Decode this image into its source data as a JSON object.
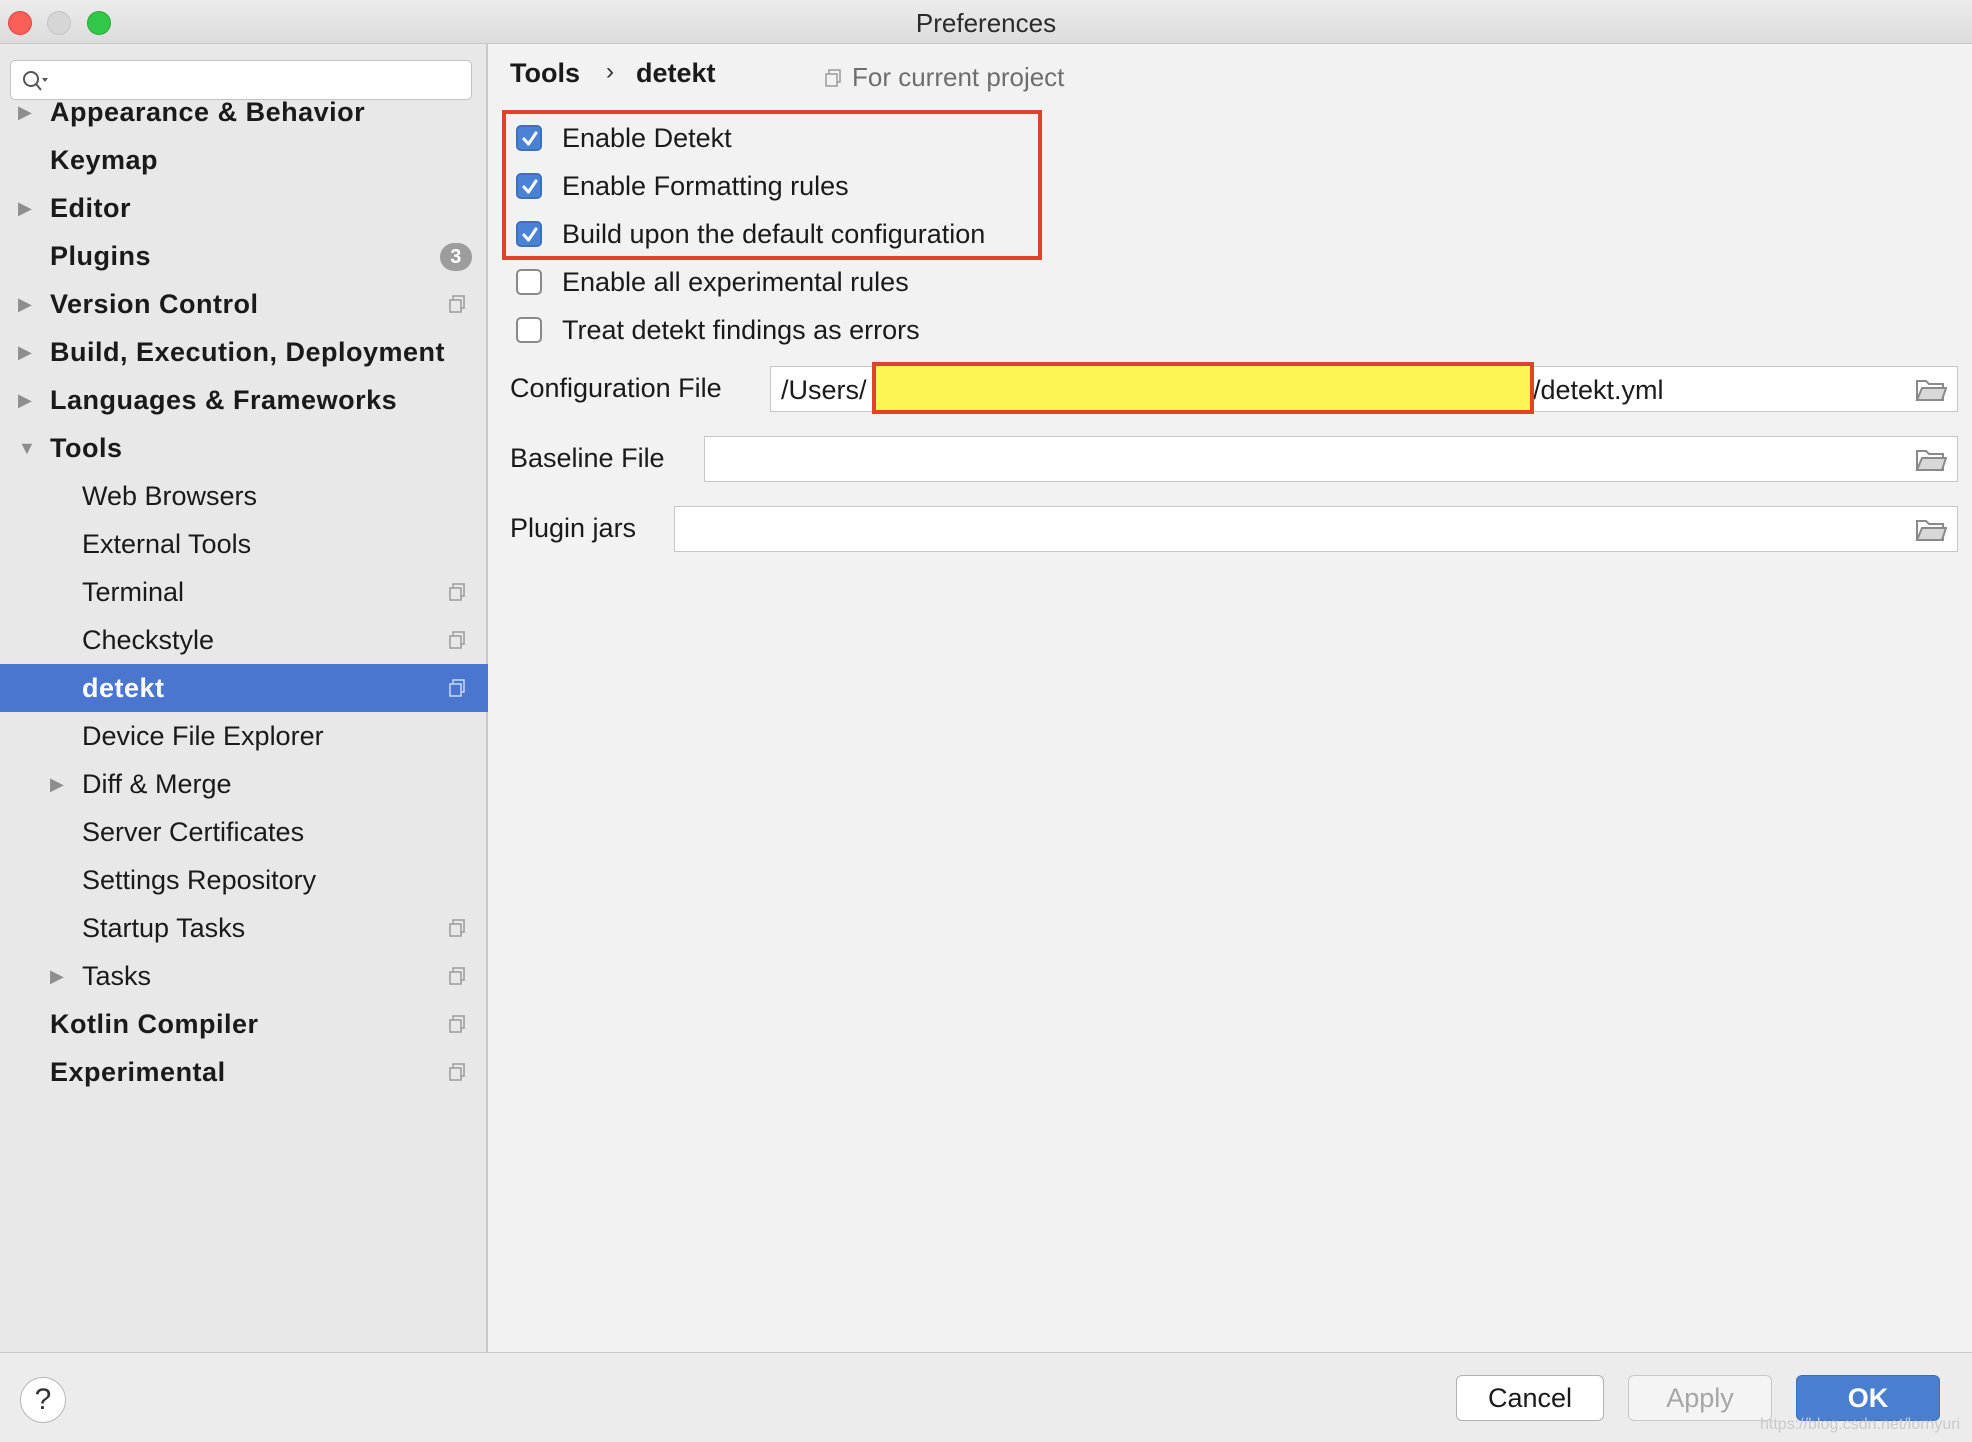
{
  "window": {
    "title": "Preferences"
  },
  "search": {
    "placeholder": ""
  },
  "sidebar": {
    "items": [
      {
        "label": "Appearance & Behavior"
      },
      {
        "label": "Keymap"
      },
      {
        "label": "Editor"
      },
      {
        "label": "Plugins",
        "badge": "3"
      },
      {
        "label": "Version Control"
      },
      {
        "label": "Build, Execution, Deployment"
      },
      {
        "label": "Languages & Frameworks"
      },
      {
        "label": "Tools"
      },
      {
        "label": "Web Browsers"
      },
      {
        "label": "External Tools"
      },
      {
        "label": "Terminal"
      },
      {
        "label": "Checkstyle"
      },
      {
        "label": "detekt"
      },
      {
        "label": "Device File Explorer"
      },
      {
        "label": "Diff & Merge"
      },
      {
        "label": "Server Certificates"
      },
      {
        "label": "Settings Repository"
      },
      {
        "label": "Startup Tasks"
      },
      {
        "label": "Tasks"
      },
      {
        "label": "Kotlin Compiler"
      },
      {
        "label": "Experimental"
      }
    ],
    "selected": "detekt"
  },
  "breadcrumb": {
    "parent": "Tools",
    "separator": "›",
    "current": "detekt",
    "scope": "For current project"
  },
  "options": [
    {
      "label": "Enable Detekt",
      "checked": true
    },
    {
      "label": "Enable Formatting rules",
      "checked": true
    },
    {
      "label": "Build upon the default configuration",
      "checked": true
    },
    {
      "label": "Enable all experimental rules",
      "checked": false
    },
    {
      "label": "Treat detekt findings as errors",
      "checked": false
    }
  ],
  "fields": {
    "config": {
      "label": "Configuration File",
      "prefix": "/Users/",
      "suffix": "/detekt.yml"
    },
    "baseline": {
      "label": "Baseline File",
      "value": ""
    },
    "plugin_jars": {
      "label": "Plugin jars",
      "value": ""
    }
  },
  "buttons": {
    "help": "?",
    "cancel": "Cancel",
    "apply": "Apply",
    "ok": "OK"
  },
  "watermark": "https://blog.csdn.net/lornyuri",
  "colors": {
    "selection": "#4a76cf",
    "annotation": "#e2412c",
    "redaction": "#fdf652",
    "primary_button": "#4a7fd0"
  },
  "icons": [
    "search-icon",
    "folder-icon",
    "project-scope-icon",
    "expand-arrow-icon",
    "collapse-arrow-icon",
    "help-icon"
  ]
}
